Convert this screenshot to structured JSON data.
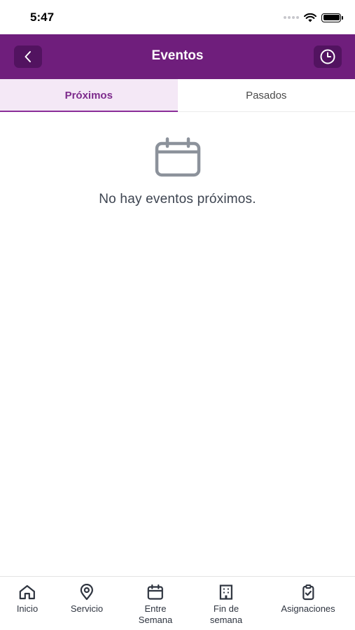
{
  "status_bar": {
    "time": "5:47"
  },
  "header": {
    "title": "Eventos"
  },
  "tabs": [
    {
      "label": "Próximos",
      "active": true
    },
    {
      "label": "Pasados",
      "active": false
    }
  ],
  "empty_state": {
    "message": "No hay eventos próximos."
  },
  "bottom_nav": [
    {
      "label": "Inicio",
      "icon": "home-icon"
    },
    {
      "label": "Servicio",
      "icon": "location-pin-icon"
    },
    {
      "label": "Entre\nSemana",
      "icon": "calendar-icon"
    },
    {
      "label": "Fin de\nsemana",
      "icon": "building-icon"
    },
    {
      "label": "Asignaciones",
      "icon": "clipboard-check-icon"
    }
  ],
  "colors": {
    "brand": "#6f1e7c",
    "brand_dark": "#521360",
    "tab_active_bg": "#f4e8f6",
    "tab_active_text": "#7d2b8c"
  }
}
